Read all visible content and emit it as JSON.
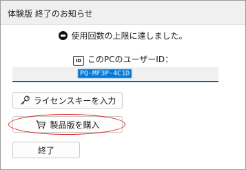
{
  "window": {
    "title": "体験版 終了のお知らせ"
  },
  "message": {
    "icon": "stop-icon",
    "text": "使用回数の上限に達しました。"
  },
  "user_id": {
    "icon": "id-icon",
    "icon_text": "ID",
    "label": "このPCのユーザーID：",
    "value": "PQ-MF3P-4C1D"
  },
  "buttons": {
    "license": {
      "icon": "key-icon",
      "label": "ライセンスキーを入力"
    },
    "buy": {
      "icon": "cart-icon",
      "label": "製品版を購入"
    },
    "exit": {
      "label": "終了"
    }
  },
  "colors": {
    "selection": "#0078d7",
    "field_underline": "#0067c0",
    "annotation": "#e01a1a"
  }
}
